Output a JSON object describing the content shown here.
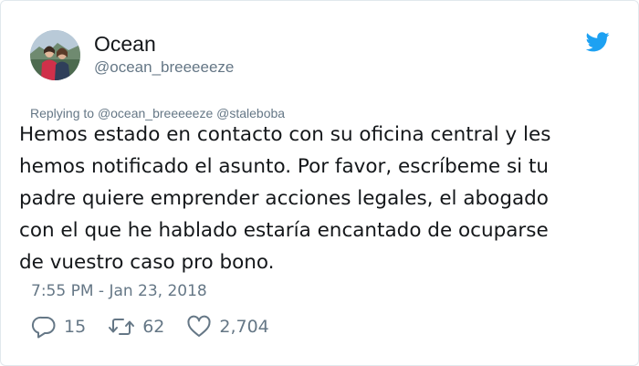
{
  "user": {
    "display_name": "Ocean",
    "handle": "@ocean_breeeeeze"
  },
  "reply": {
    "prefix": "Replying to",
    "mentions": [
      "@ocean_breeeeeze",
      "@staleboba"
    ]
  },
  "tweet": {
    "lines": [
      "Hemos estado en contacto con su oficina central y les",
      "hemos notificado el asunto. Por favor, escríbeme si tu",
      "padre quiere emprender acciones legales, el abogado",
      "con el que he hablado estaría encantado de ocuparse",
      "de vuestro caso pro bono."
    ],
    "timestamp": "7:55 PM - Jan 23, 2018"
  },
  "stats": {
    "replies": "15",
    "retweets": "62",
    "likes": "2,704"
  },
  "icons": {
    "brand": "twitter-bird-icon",
    "reply": "reply-bubble-icon",
    "retweet": "retweet-icon",
    "like": "heart-icon"
  },
  "colors": {
    "twitter_blue": "#1da1f2",
    "text": "#14171a",
    "muted": "#657786",
    "border": "#e1e8ed"
  }
}
